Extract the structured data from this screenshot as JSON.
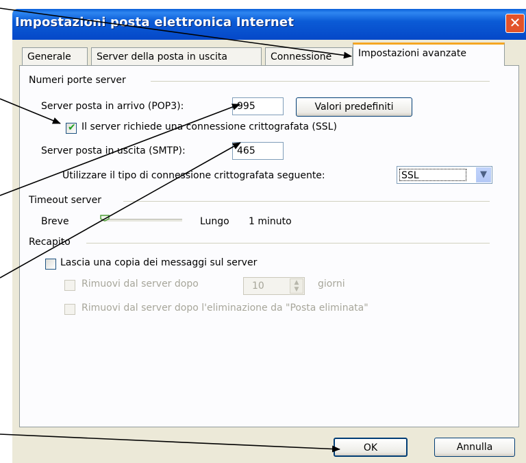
{
  "window": {
    "title": "Impostazioni posta elettronica Internet",
    "close_glyph": "✕"
  },
  "tabs": [
    {
      "label": "Generale"
    },
    {
      "label": "Server della posta in uscita"
    },
    {
      "label": "Connessione"
    },
    {
      "label": "Impostazioni avanzate"
    }
  ],
  "ports": {
    "group_label": "Numeri porte server",
    "incoming_label": "Server posta in arrivo (POP3):",
    "incoming_value": "995",
    "defaults_button": "Valori predefiniti",
    "ssl_checkbox_label": "Il server richiede una connessione crittografata (SSL)",
    "ssl_checked": true,
    "outgoing_label": "Server posta in uscita (SMTP):",
    "outgoing_value": "465",
    "encryption_label": "Utilizzare il tipo di connessione crittografata seguente:",
    "encryption_value": "SSL"
  },
  "timeout": {
    "group_label": "Timeout server",
    "short_label": "Breve",
    "long_label": "Lungo",
    "value_text": "1 minuto",
    "level": 0
  },
  "delivery": {
    "group_label": "Recapito",
    "leave_copy_label": "Lascia una copia dei messaggi sul server",
    "remove_after_label": "Rimuovi dal server dopo",
    "days_value": "10",
    "days_unit": "giorni",
    "remove_deleted_label": "Rimuovi dal server dopo l'eliminazione da \"Posta eliminata\""
  },
  "footer": {
    "ok_label": "OK",
    "cancel_label": "Annulla"
  },
  "icons": {
    "close": "close-icon",
    "dropdown": "chevron-down-icon",
    "spin": "spinner-arrows-icon",
    "check": "checkmark-icon"
  }
}
